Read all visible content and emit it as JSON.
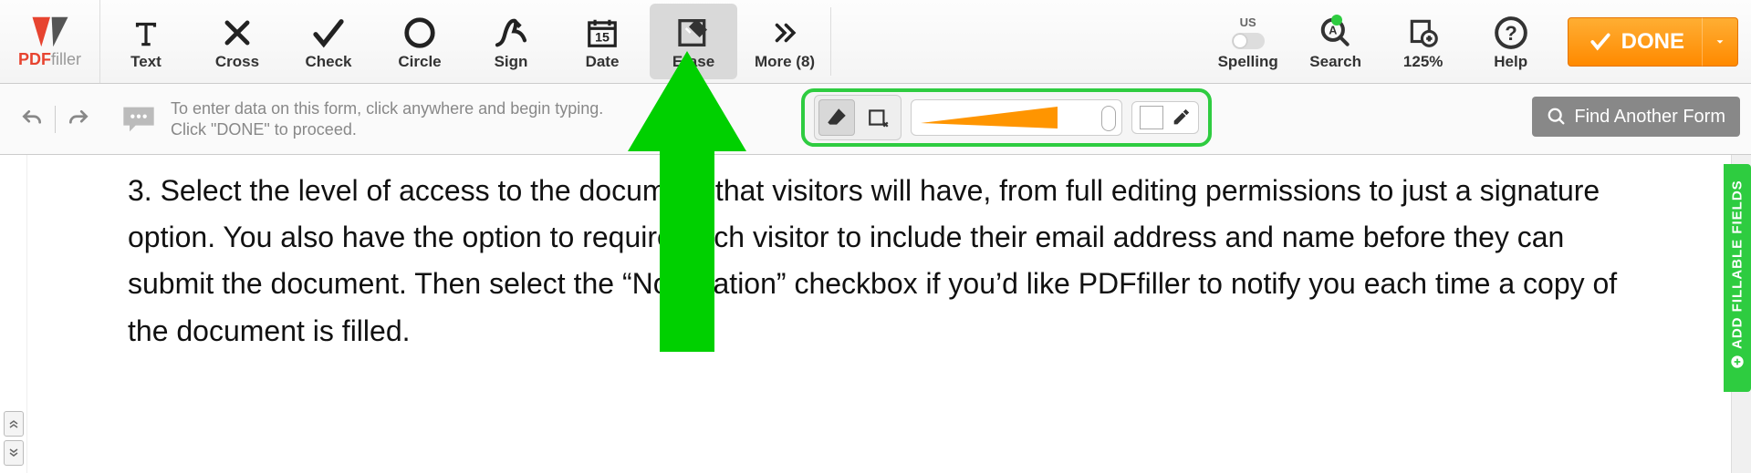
{
  "brand": {
    "pdf": "PDF",
    "filler": "filler"
  },
  "toolbar": {
    "text": "Text",
    "cross": "Cross",
    "check": "Check",
    "circle": "Circle",
    "sign": "Sign",
    "date": "Date",
    "erase": "Erase",
    "more": "More (8)"
  },
  "rightTools": {
    "spell_region": "US",
    "spelling": "Spelling",
    "search": "Search",
    "zoom": "125%",
    "help": "Help"
  },
  "done": {
    "label": "DONE"
  },
  "hint": {
    "line1": "To enter data on this form, click anywhere and begin typing.",
    "line2": "Click \"DONE\" to proceed."
  },
  "findForm": {
    "label": "Find Another Form"
  },
  "sideTab": {
    "label": "ADD FILLABLE FIELDS"
  },
  "doc": {
    "body": "3. Select the level of access to the document that visitors will have, from full editing permissions to just a signature option. You also have the option to require each visitor to include their email address and name before they can submit the document. Then select the “Notification” checkbox if you’d like PDFfiller to notify you each time a copy of the document is filled."
  },
  "erasePanel": {
    "color": "#ffffff"
  }
}
